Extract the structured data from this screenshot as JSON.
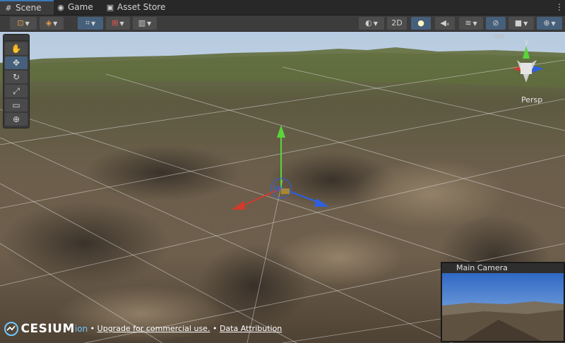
{
  "tabs": [
    {
      "label": "Scene",
      "icon": "grid-icon",
      "active": true
    },
    {
      "label": "Game",
      "icon": "gamepad-icon",
      "active": false
    },
    {
      "label": "Asset Store",
      "icon": "shopping-bag-icon",
      "active": false
    }
  ],
  "toolbar": {
    "two_d_label": "2D"
  },
  "tools": [
    {
      "name": "hand-tool-icon",
      "glyph": "✋",
      "active": false
    },
    {
      "name": "move-tool-icon",
      "glyph": "✥",
      "active": true
    },
    {
      "name": "rotate-tool-icon",
      "glyph": "↻",
      "active": false
    },
    {
      "name": "scale-tool-icon",
      "glyph": "⤢",
      "active": false
    },
    {
      "name": "rect-tool-icon",
      "glyph": "▭",
      "active": false
    },
    {
      "name": "transform-tool-icon",
      "glyph": "⊕",
      "active": false
    }
  ],
  "scene": {
    "projection_label": "Persp",
    "gizmo_axis_label": "y"
  },
  "camera_preview": {
    "title": "Main Camera"
  },
  "attribution": {
    "logo_text": "CESIUM",
    "logo_suffix": "ion",
    "separator": "•",
    "upgrade_link": "Upgrade for commercial use.",
    "data_link": "Data Attribution"
  },
  "colors": {
    "accent": "#3a79bb",
    "axis_x": "#d23a2a",
    "axis_y": "#5ad43a",
    "axis_z": "#2f5fe0"
  }
}
